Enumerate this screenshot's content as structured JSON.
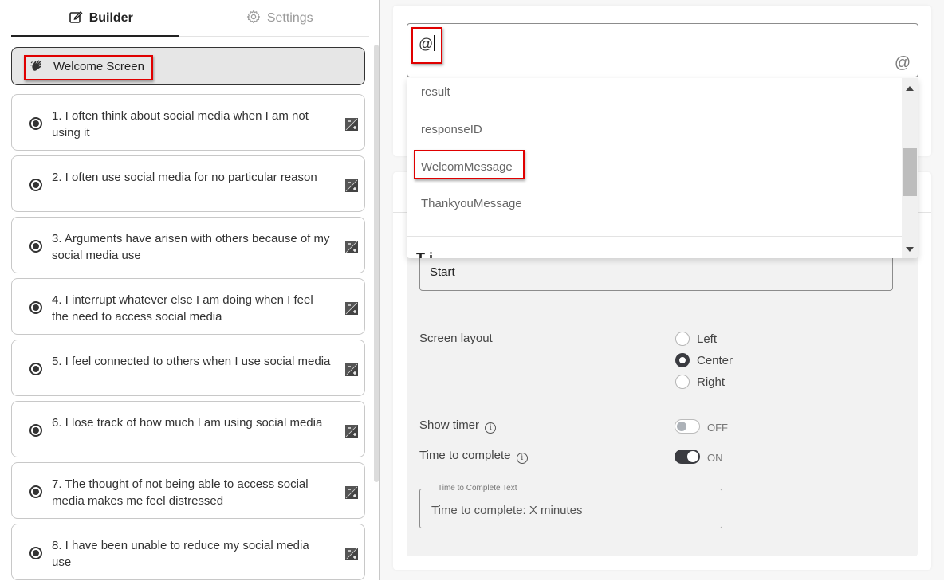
{
  "tabs": [
    {
      "label": "Builder",
      "icon": "edit-icon",
      "active": true
    },
    {
      "label": "Settings",
      "icon": "gear-icon",
      "active": false
    }
  ],
  "welcome": {
    "label": "Welcome Screen",
    "icon": "waving-hand-icon"
  },
  "questions": [
    {
      "text": "1. I often think about social media when I am not using it"
    },
    {
      "text": "2. I often use social media for no particular reason"
    },
    {
      "text": "3. Arguments have arisen with others because of my social media use"
    },
    {
      "text": "4. I interrupt whatever else I am doing when I feel the need to access social media"
    },
    {
      "text": "5. I feel connected to others when I use social media"
    },
    {
      "text": "6. I lose track of how much I am using social media"
    },
    {
      "text": "7. The thought of not being able to access social media makes me feel distressed"
    },
    {
      "text": "8. I have been unable to reduce my social media use"
    }
  ],
  "mention_input": {
    "value": "@",
    "button_icon": "@"
  },
  "dropdown": {
    "items": [
      "result",
      "responseID",
      "WelcomMessage",
      "ThankyouMessage"
    ],
    "highlighted": "WelcomMessage",
    "partial_heading": "T      i"
  },
  "start_button_field": {
    "value": "Start"
  },
  "screen_layout": {
    "label": "Screen layout",
    "options": [
      "Left",
      "Center",
      "Right"
    ],
    "selected": "Center"
  },
  "show_timer": {
    "label": "Show timer",
    "info_icon": "i",
    "state": "OFF"
  },
  "time_to_complete": {
    "label": "Time to complete",
    "info_icon": "i",
    "state": "ON"
  },
  "time_text_field": {
    "legend": "Time to Complete Text",
    "value": "Time to complete: X minutes"
  },
  "colors": {
    "highlight": "#e00000",
    "toggle_on": "#3a3b40",
    "panel_bg": "#f2f2f2"
  }
}
